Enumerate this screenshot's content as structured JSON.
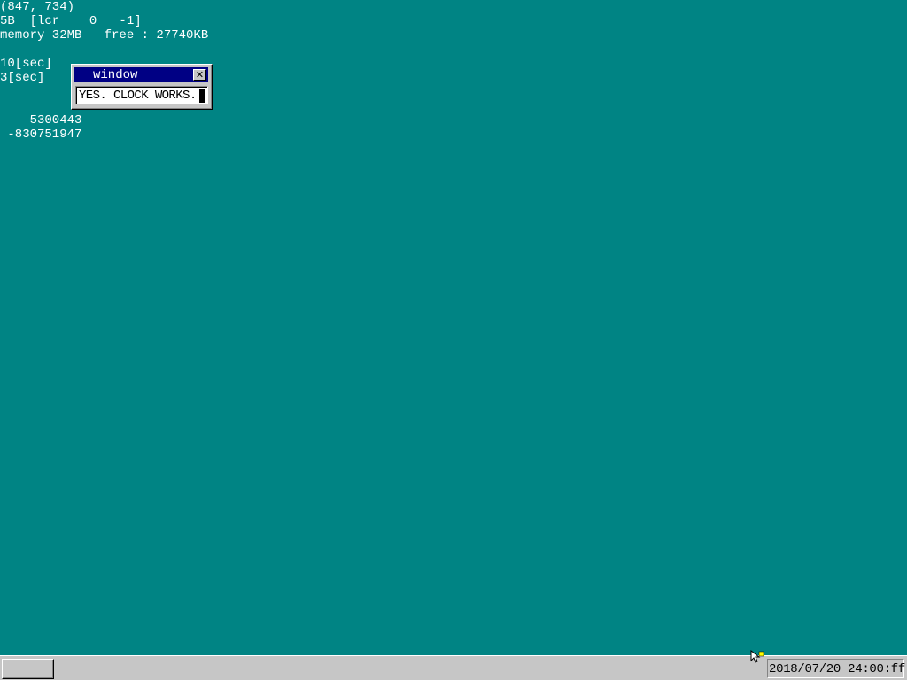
{
  "desktop": {
    "background_color": "#008484",
    "debug_lines": {
      "mouse_coords": "(847, 734)",
      "key_status": "5B  [lcr    0   -1]",
      "memory": "memory 32MB   free : 27740KB",
      "timer_10": "10[sec]",
      "timer_3": "3[sec]",
      "count_1": "    5300443",
      "count_2": " -830751947"
    }
  },
  "window": {
    "title": "window",
    "close_icon": "close-icon",
    "textbox_value": "YES. CLOCK WORKS.",
    "title_bar_color": "#000084"
  },
  "taskbar": {
    "start_button_label": "",
    "clock_text": "2018/07/20 24:00:ff",
    "background_color": "#c6c6c6"
  },
  "mouse": {
    "icon": "mouse-pointer-icon"
  }
}
